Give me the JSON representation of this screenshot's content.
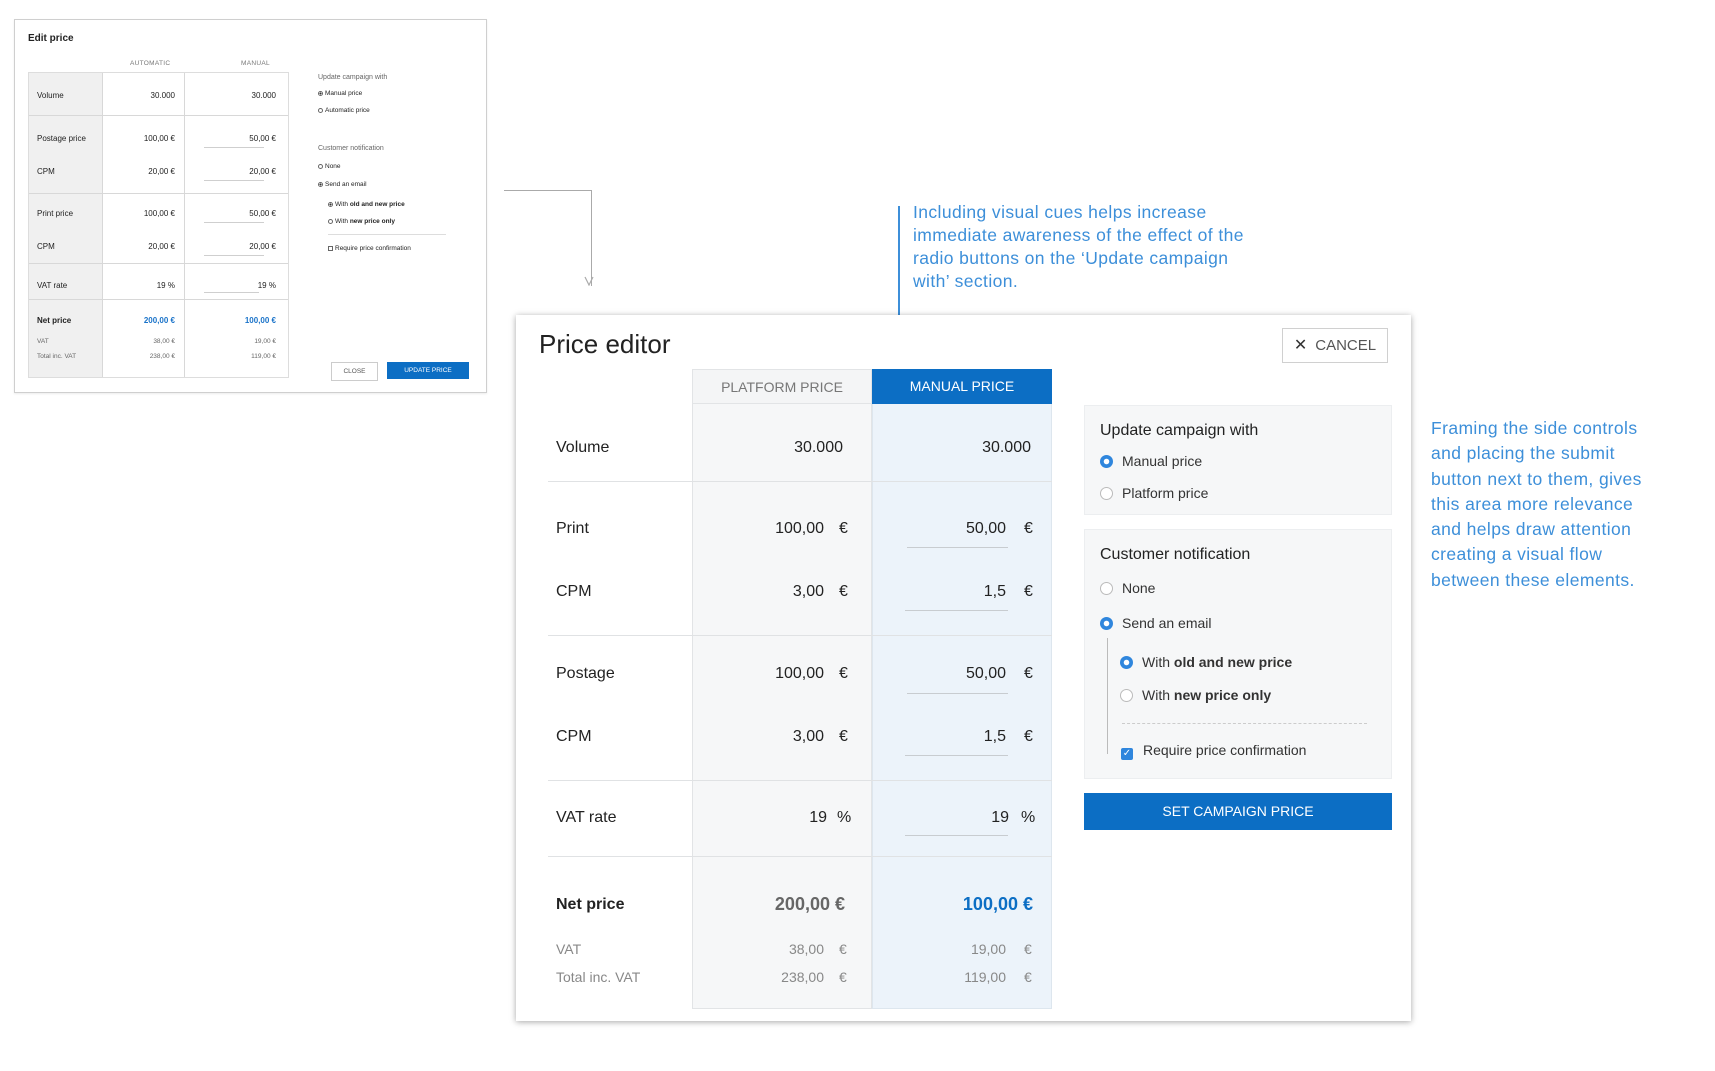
{
  "old_dialog": {
    "title": "Edit price",
    "col_automatic": "AUTOMATIC",
    "col_manual": "MANUAL",
    "rows": {
      "volume": {
        "label": "Volume",
        "auto": "30.000",
        "manual": "30.000"
      },
      "postage": {
        "label": "Postage price",
        "auto": "100,00 €",
        "manual": "50,00 €"
      },
      "postage_cpm": {
        "label": "CPM",
        "auto": "20,00 €",
        "manual": "20,00 €"
      },
      "print": {
        "label": "Print price",
        "auto": "100,00 €",
        "manual": "50,00 €"
      },
      "print_cpm": {
        "label": "CPM",
        "auto": "20,00 €",
        "manual": "20,00 €"
      },
      "vat_rate": {
        "label": "VAT rate",
        "auto": "19",
        "manual": "19",
        "unit": "%"
      },
      "net": {
        "label": "Net price",
        "auto": "200,00 €",
        "manual": "100,00 €"
      },
      "vat": {
        "label": "VAT",
        "auto": "38,00 €",
        "manual": "19,00 €"
      },
      "total": {
        "label": "Total inc. VAT",
        "auto": "238,00 €",
        "manual": "119,00 €"
      }
    },
    "update_campaign": {
      "heading": "Update campaign with",
      "manual": "Manual price",
      "automatic": "Automatic price"
    },
    "notification": {
      "heading": "Customer notification",
      "none": "None",
      "email": "Send an email",
      "with_old_pre": "With ",
      "with_old_bold": "old and new price",
      "with_new_pre": "With ",
      "with_new_bold": "new price only",
      "require": "Require price confirmation"
    },
    "close_label": "CLOSE",
    "update_label": "UPDATE PRICE"
  },
  "annotations": {
    "top": [
      "Including visual cues helps increase",
      "immediate awareness of the effect of the",
      "radio buttons on the ‘Update campaign",
      "with’ section."
    ],
    "right": [
      "Framing the side controls",
      "and placing the submit",
      "button next to them, gives",
      "this area more relevance",
      "and helps draw attention",
      "creating a visual flow",
      "between these elements."
    ],
    "color": "#3d8fd9"
  },
  "editor": {
    "title": "Price editor",
    "cancel_label": "CANCEL",
    "platform_head": "PLATFORM PRICE",
    "manual_head": "MANUAL PRICE",
    "rows": {
      "volume": {
        "label": "Volume",
        "platform": "30.000",
        "manual": "30.000"
      },
      "print": {
        "label": "Print",
        "platform": "100,00",
        "manual": "50,00"
      },
      "print_cpm": {
        "label": "CPM",
        "platform": "3,00",
        "manual": "1,5"
      },
      "postage": {
        "label": "Postage",
        "platform": "100,00",
        "manual": "50,00"
      },
      "postage_cpm": {
        "label": "CPM",
        "platform": "3,00",
        "manual": "1,5"
      },
      "vat_rate": {
        "label": "VAT rate",
        "platform": "19",
        "manual": "19"
      },
      "net": {
        "label": "Net price",
        "platform": "200,00 €",
        "manual": "100,00 €"
      },
      "vat": {
        "label": "VAT",
        "platform": "38,00",
        "manual": "19,00"
      },
      "total": {
        "label": "Total inc. VAT",
        "platform": "238,00",
        "manual": "119,00"
      }
    },
    "currency": "€",
    "percent": "%",
    "update_campaign": {
      "heading": "Update campaign with",
      "manual": "Manual price",
      "platform": "Platform price"
    },
    "notification": {
      "heading": "Customer notification",
      "none": "None",
      "email": "Send an email",
      "with_old_pre": "With ",
      "with_old_bold": "old and new price",
      "with_new_pre": "With ",
      "with_new_bold": "new price only",
      "require": "Require price confirmation"
    },
    "submit_label": "SET CAMPAIGN PRICE",
    "accent": "#0c6ec4"
  }
}
